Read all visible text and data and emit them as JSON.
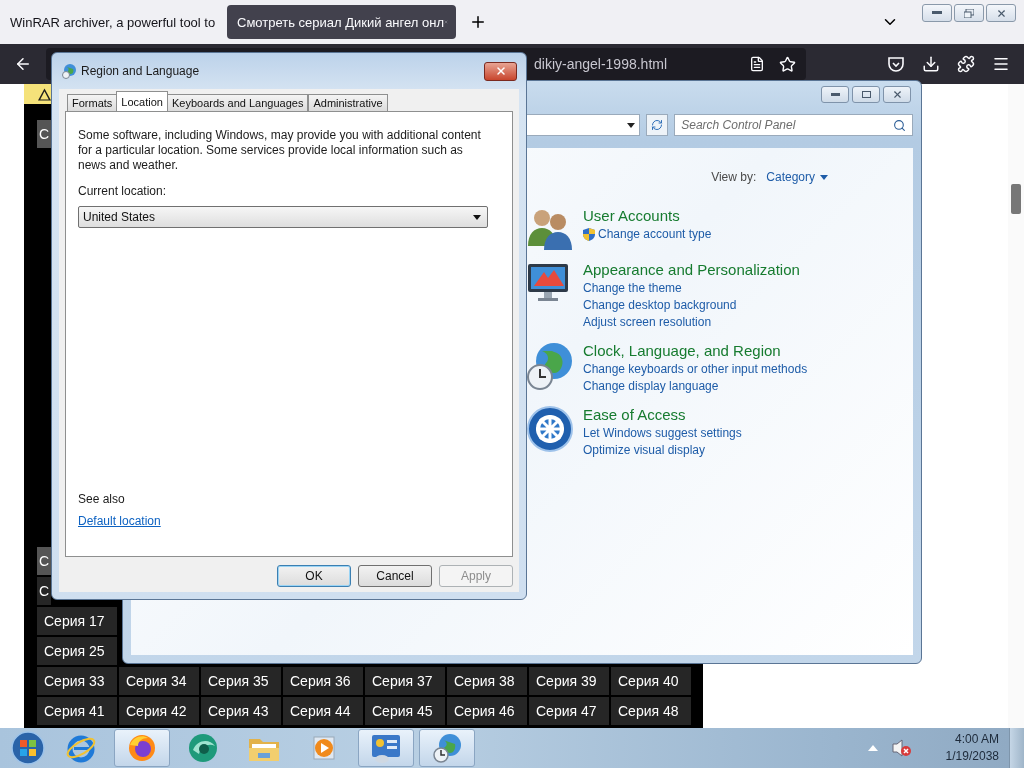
{
  "browser": {
    "tabs": [
      {
        "title": "WinRAR archiver, a powerful tool to",
        "selected": false
      },
      {
        "title": "Смотреть сериал Дикий ангел онл",
        "selected": true
      }
    ],
    "url": "dikiy-angel-1998.html"
  },
  "page": {
    "top_cell": {
      "label": "С",
      "highlighted": true,
      "clipped": true
    },
    "rows": [
      [
        {
          "label": "С",
          "highlighted": true,
          "clipped": true
        }
      ],
      [
        {
          "label": "С",
          "highlighted": false,
          "clipped": true
        }
      ],
      [
        {
          "label": "Серия 17",
          "highlighted": false,
          "clipped": false
        }
      ],
      [
        {
          "label": "Серия 25",
          "highlighted": false,
          "clipped": false
        }
      ],
      [
        {
          "label": "Серия 33",
          "highlighted": false,
          "clipped": false
        },
        {
          "label": "Серия 34",
          "highlighted": false,
          "clipped": false
        },
        {
          "label": "Серия 35",
          "highlighted": false,
          "clipped": false
        },
        {
          "label": "Серия 36",
          "highlighted": false,
          "clipped": false
        },
        {
          "label": "Серия 37",
          "highlighted": false,
          "clipped": false
        },
        {
          "label": "Серия 38",
          "highlighted": false,
          "clipped": false
        },
        {
          "label": "Серия 39",
          "highlighted": false,
          "clipped": false
        },
        {
          "label": "Серия 40",
          "highlighted": false,
          "clipped": false
        }
      ],
      [
        {
          "label": "Серия 41",
          "highlighted": false,
          "clipped": false
        },
        {
          "label": "Серия 42",
          "highlighted": false,
          "clipped": false
        },
        {
          "label": "Серия 43",
          "highlighted": false,
          "clipped": false
        },
        {
          "label": "Серия 44",
          "highlighted": false,
          "clipped": false
        },
        {
          "label": "Серия 45",
          "highlighted": false,
          "clipped": false
        },
        {
          "label": "Серия 46",
          "highlighted": false,
          "clipped": false
        },
        {
          "label": "Серия 47",
          "highlighted": false,
          "clipped": false
        },
        {
          "label": "Серия 48",
          "highlighted": false,
          "clipped": false
        }
      ]
    ]
  },
  "control_panel": {
    "search": {
      "placeholder": "Search Control Panel"
    },
    "view_by": {
      "label": "View by:",
      "value": "Category"
    },
    "categories": [
      {
        "kind": "users",
        "title": "User Accounts",
        "links": [
          {
            "label": "Change account type",
            "shield": true
          }
        ]
      },
      {
        "kind": "appearance",
        "title": "Appearance and Personalization",
        "links": [
          {
            "label": "Change the theme",
            "shield": false
          },
          {
            "label": "Change desktop background",
            "shield": false
          },
          {
            "label": "Adjust screen resolution",
            "shield": false
          }
        ]
      },
      {
        "kind": "clock",
        "title": "Clock, Language, and Region",
        "links": [
          {
            "label": "Change keyboards or other input methods",
            "shield": false
          },
          {
            "label": "Change display language",
            "shield": false
          }
        ]
      },
      {
        "kind": "access",
        "title": "Ease of Access",
        "links": [
          {
            "label": "Let Windows suggest settings",
            "shield": false
          },
          {
            "label": "Optimize visual display",
            "shield": false
          }
        ]
      }
    ]
  },
  "dialog": {
    "title": "Region and Language",
    "tabs": [
      {
        "label": "Formats",
        "selected": false
      },
      {
        "label": "Location",
        "selected": true
      },
      {
        "label": "Keyboards and Languages",
        "selected": false
      },
      {
        "label": "Administrative",
        "selected": false
      }
    ],
    "description": "Some software, including Windows, may provide you with additional content for a particular location. Some services provide local information such as news and weather.",
    "location_label": "Current location:",
    "location_value": "United States",
    "see_also": "See also",
    "link": "Default location",
    "buttons": [
      {
        "label": "OK",
        "kind": "default",
        "disabled": false
      },
      {
        "label": "Cancel",
        "kind": "normal",
        "disabled": false
      },
      {
        "label": "Apply",
        "kind": "normal",
        "disabled": true
      }
    ]
  },
  "taskbar": {
    "apps": [
      {
        "kind": "ie",
        "active": false
      },
      {
        "kind": "firefox",
        "active": true
      },
      {
        "kind": "green",
        "active": false
      },
      {
        "kind": "folder",
        "active": false
      },
      {
        "kind": "media",
        "active": false
      },
      {
        "kind": "panel",
        "active": true
      },
      {
        "kind": "region",
        "active": true
      }
    ],
    "time": "4:00 AM",
    "date": "1/19/2038"
  }
}
